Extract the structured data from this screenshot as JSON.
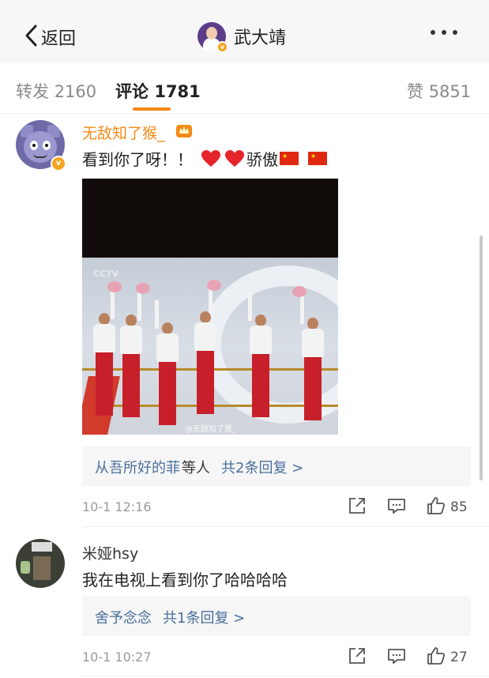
{
  "header": {
    "back_label": "返回",
    "title": "武大靖"
  },
  "tabs": {
    "repost_label": "转发",
    "repost_count": "2160",
    "comment_label": "评论",
    "comment_count": "1781",
    "like_label": "赞",
    "like_count": "5851"
  },
  "comments": [
    {
      "username": "无敌知了猴_",
      "text_prefix": "看到你了呀！！",
      "text_mid": "骄傲",
      "video_logo": "CCTV",
      "video_watermark": "@无敌知了猴_",
      "reply_users": "从吾所好的菲",
      "reply_suffix": "等人",
      "reply_count": "共2条回复 >",
      "time": "10-1 12:16",
      "like_count": "85"
    },
    {
      "username": "米娅hsy",
      "text": "我在电视上看到你了哈哈哈哈",
      "reply_users": "舍予念念",
      "reply_count": "共1条回复 >",
      "time": "10-1 10:27",
      "like_count": "27"
    }
  ],
  "colors": {
    "accent": "#f48a16",
    "link": "#4a6f9b",
    "verified": "#f5a623"
  }
}
